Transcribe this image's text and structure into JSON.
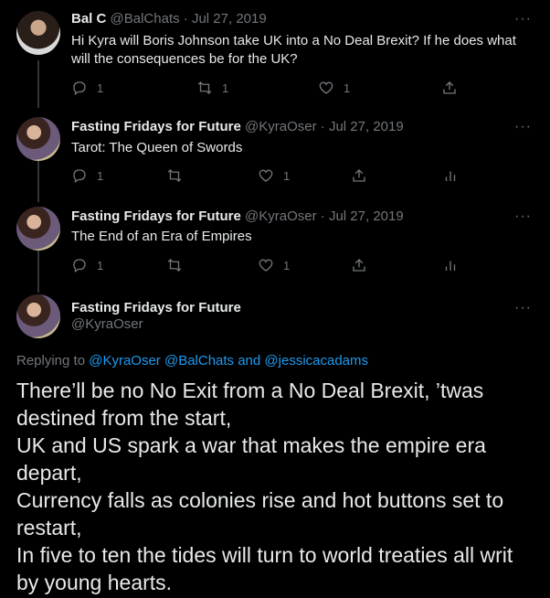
{
  "tweets": [
    {
      "name": "Bal C",
      "handle": "@BalChats",
      "date": "Jul 27, 2019",
      "text": "Hi Kyra will Boris Johnson take UK into a No Deal Brexit? If he does what will the consequences be for the UK?",
      "reply_count": "1",
      "retweet_count": "1",
      "like_count": "1"
    },
    {
      "name": "Fasting Fridays for Future",
      "handle": "@KyraOser",
      "date": "Jul 27, 2019",
      "text": "Tarot: The Queen of Swords",
      "reply_count": "1",
      "like_count": "1"
    },
    {
      "name": "Fasting Fridays for Future",
      "handle": "@KyraOser",
      "date": "Jul 27, 2019",
      "text": "The End of an Era of Empires",
      "reply_count": "1",
      "like_count": "1"
    }
  ],
  "main": {
    "name": "Fasting Fridays for Future",
    "handle": "@KyraOser",
    "replying_prefix": "Replying to",
    "replying_targets": "@KyraOser @BalChats and @jessicacadams",
    "body": "There’ll be no No Exit from a No Deal Brexit, ’twas destined from the start,\nUK and US spark a war that makes the empire era depart,\nCurrency falls as colonies rise and hot buttons set to restart,\nIn five to ten the tides will turn to world treaties all writ by young hearts."
  },
  "ui": {
    "more_glyph": "···",
    "dot": "·"
  }
}
